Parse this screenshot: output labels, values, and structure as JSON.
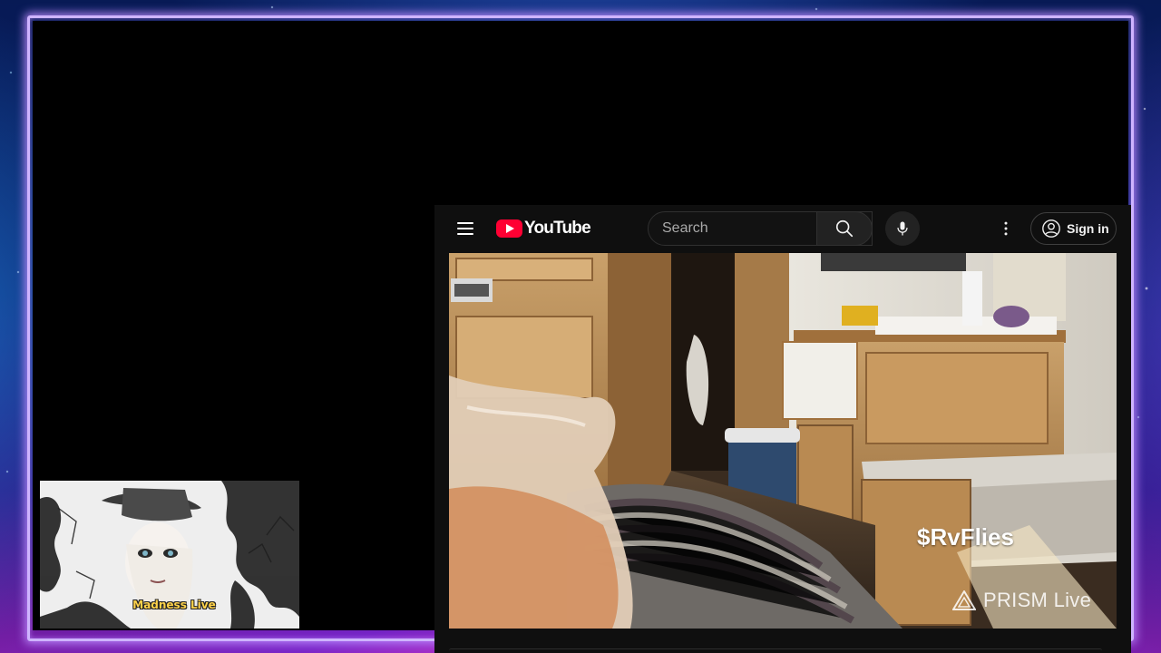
{
  "webcam": {
    "title": "Madness Live"
  },
  "youtube": {
    "logo_text": "YouTube",
    "search": {
      "placeholder": "Search",
      "value": ""
    },
    "sign_in_label": "Sign in",
    "icons": {
      "menu": "hamburger-menu-icon",
      "logo": "youtube-logo-icon",
      "search": "search-icon",
      "mic": "microphone-icon",
      "more": "more-vertical-icon",
      "account": "account-circle-icon"
    },
    "colors": {
      "logo_red": "#ff0033",
      "header_bg": "#0f0f0f"
    }
  },
  "video": {
    "overlay_name": "$RvFlies",
    "watermark": "PRISM Live"
  }
}
